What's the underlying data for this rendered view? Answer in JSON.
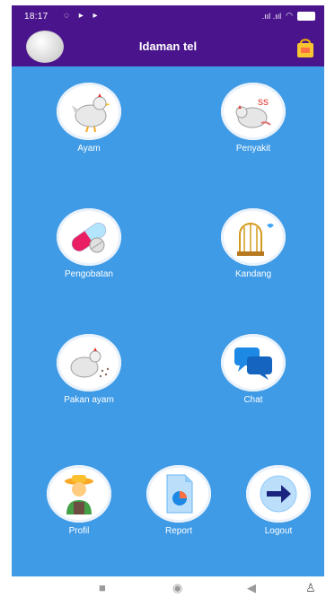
{
  "status_bar": {
    "time": "18:17",
    "signal": ".ııl .ııl",
    "battery": "100"
  },
  "header": {
    "title": "Idaman tel"
  },
  "menu": {
    "ayam": "Ayam",
    "penyakit": "Penyakit",
    "pengobatan": "Pengobatan",
    "kandang": "Kandang",
    "pakan": "Pakan ayam",
    "chat": "Chat",
    "profil": "Profil",
    "report": "Report",
    "logout": "Logout"
  },
  "icons": {
    "ayam": "chicken-icon",
    "penyakit": "sick-chicken-icon",
    "pengobatan": "pill-icon",
    "kandang": "birdcage-icon",
    "pakan": "feeding-chicken-icon",
    "chat": "chat-bubbles-icon",
    "profil": "farmer-icon",
    "report": "report-document-icon",
    "logout": "arrow-right-icon",
    "bag": "shopping-bag-icon"
  },
  "colors": {
    "topbar": "#4a148c",
    "background": "#3f9be6"
  }
}
